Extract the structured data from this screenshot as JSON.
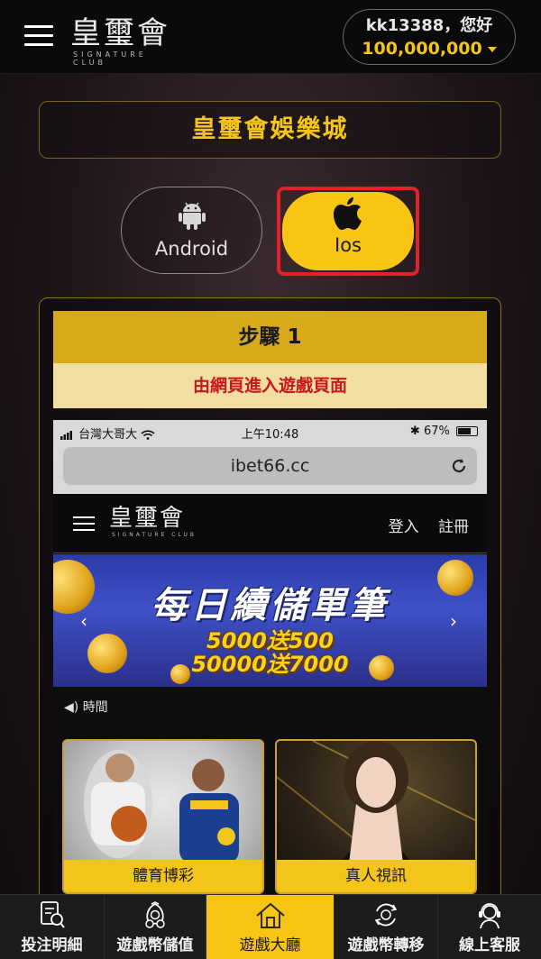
{
  "header": {
    "logo_text": "皇璽會",
    "logo_sub": "SIGNATURE CLUB",
    "user_greeting": "kk13388，您好",
    "balance": "100,000,000"
  },
  "page_title": "皇璽會娛樂城",
  "os_options": {
    "android_label": "Android",
    "ios_label": "Ios",
    "selected": "Ios"
  },
  "step": {
    "title": "步驟 1",
    "instruction": "由網頁進入遊戲頁面"
  },
  "phone_screen": {
    "status_carrier": "台灣大哥大",
    "status_time": "上午10:48",
    "status_battery": "67%",
    "url": "ibet66.cc",
    "site_logo": "皇璽會",
    "site_logo_sub": "SIGNATURE CLUB",
    "nav_login": "登入",
    "nav_register": "註冊",
    "banner_title": "每日續儲單筆",
    "banner_line1": "5000送500",
    "banner_line2": "50000送7000",
    "marquee_text": "時間",
    "cards": [
      {
        "label": "體育博彩"
      },
      {
        "label": "真人視訊"
      }
    ]
  },
  "bottom_nav": [
    {
      "label": "投注明細",
      "icon": "betting-record-icon"
    },
    {
      "label": "遊戲幣儲值",
      "icon": "coin-deposit-icon"
    },
    {
      "label": "遊戲大廳",
      "icon": "home-icon",
      "active": true
    },
    {
      "label": "遊戲幣轉移",
      "icon": "transfer-icon"
    },
    {
      "label": "線上客服",
      "icon": "customer-service-icon"
    }
  ],
  "colors": {
    "accent_gold": "#f8c514",
    "highlight_red": "#e4212a",
    "instruction_red": "#c8171d"
  }
}
